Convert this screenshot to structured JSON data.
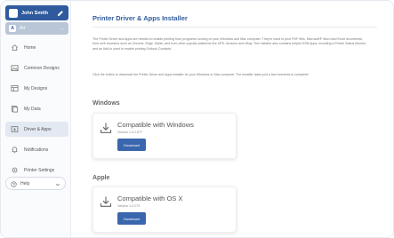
{
  "colors": {
    "accent": "#2f5a9e",
    "button": "#3a66ad",
    "active_nav": "#e3e9f2"
  },
  "user": {
    "name": "John Smith",
    "edit_icon": "pencil-icon"
  },
  "org": {
    "badge": "A",
    "name": "Art",
    "more_label": "..."
  },
  "nav": {
    "items": [
      {
        "label": "Home",
        "icon": "home-icon",
        "active": false
      },
      {
        "label": "Common Designs",
        "icon": "image-icon",
        "active": false
      },
      {
        "label": "My Designs",
        "icon": "design-icon",
        "active": false
      },
      {
        "label": "My Data",
        "icon": "database-icon",
        "active": false
      },
      {
        "label": "Driver & Apps",
        "icon": "download-icon",
        "active": true
      },
      {
        "label": "Notifications",
        "icon": "bell-icon",
        "active": false
      },
      {
        "label": "Printer Settings",
        "icon": "gear-icon",
        "active": false
      }
    ]
  },
  "help": {
    "label": "Help",
    "icon": "help-icon",
    "chevron": "chevron-down-icon"
  },
  "main": {
    "title": "Printer Driver & Apps Installer",
    "paragraph1": "The Printer Driver and Apps are needed to enable printing from programs running on your Windows and Mac computer. They're used to print PDF files, Microsoft® Word and Excel documents, from web browsers such as Chrome, Edge, Safari, and from other popular platforms like UPS, Amazon and eBay. This installer also contains helpful DSN Apps, including a Printer Status Monitor and an Add-in used to enable printing Outlook Contacts.",
    "paragraph2": "Click the button to download the Printer Driver and Apps installer for your Windows or Mac computer. The installer takes just a few moments to complete!",
    "sections": {
      "windows": {
        "title": "Windows",
        "card_title": "Compatible with Windows",
        "version": "Version 1.0.2.677",
        "button": "Download"
      },
      "apple": {
        "title": "Apple",
        "card_title": "Compatible with OS X",
        "version": "Version 1.0.275",
        "button": "Download"
      }
    }
  }
}
